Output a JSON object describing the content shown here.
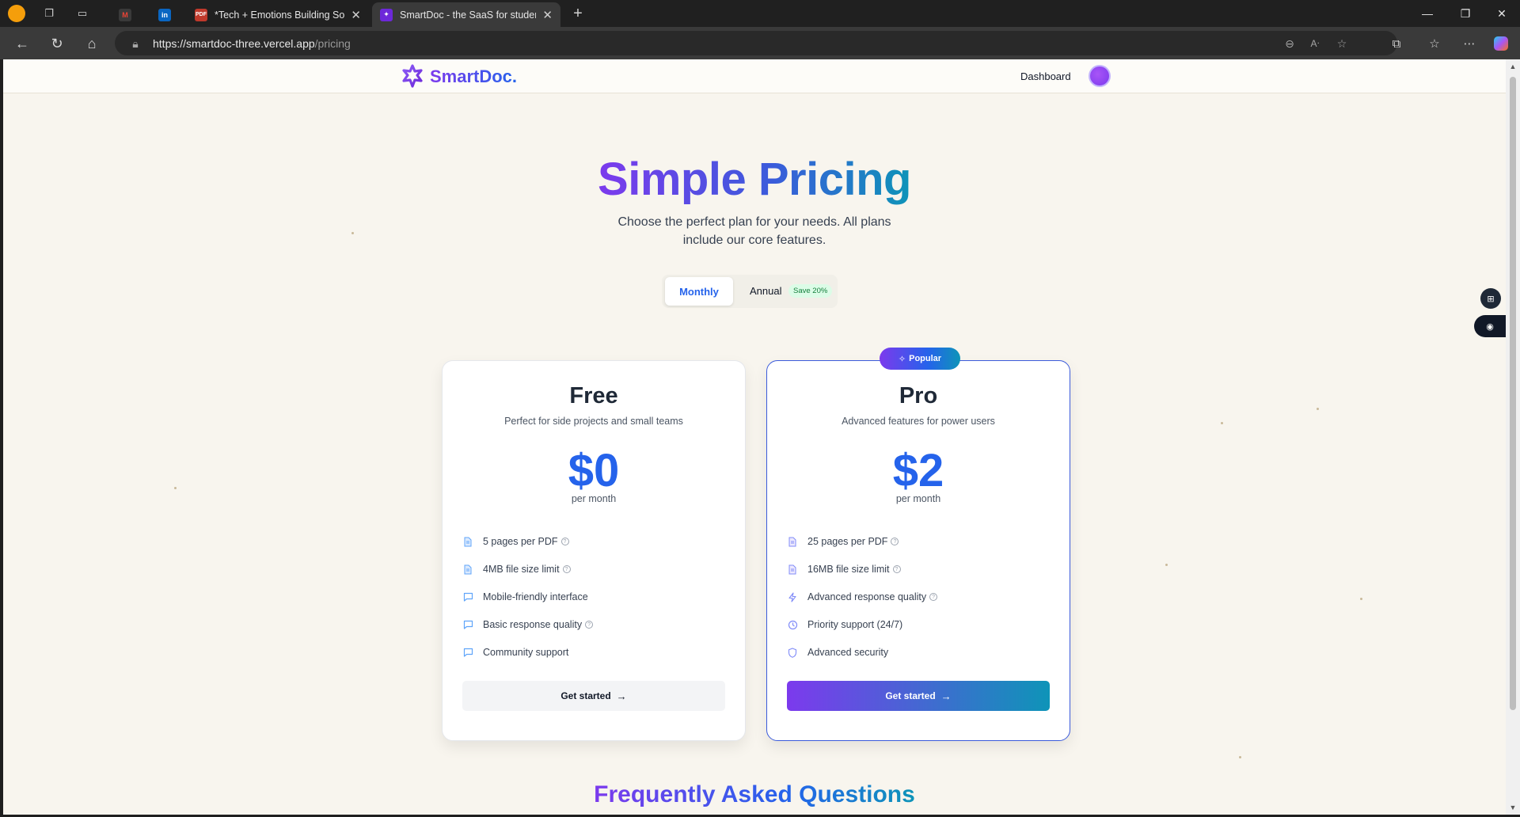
{
  "browser": {
    "tabs": [
      {
        "title": "",
        "favicon": "gmail-icon"
      },
      {
        "title": "",
        "favicon": "linkedin-icon"
      },
      {
        "title": "*Tech + Emotions Building Softwa",
        "favicon": "pdf-icon"
      },
      {
        "title": "SmartDoc - the SaaS for students",
        "favicon": "smartdoc-icon",
        "active": true
      }
    ],
    "url_host": "https://smartdoc-three.vercel.app",
    "url_path": "/pricing"
  },
  "header": {
    "logo_text": "SmartDoc.",
    "dashboard_label": "Dashboard"
  },
  "hero": {
    "title": "Simple Pricing",
    "subtitle": "Choose the perfect plan for your needs. All plans include our core features."
  },
  "billing_toggle": {
    "monthly_label": "Monthly",
    "annual_label": "Annual",
    "save_badge": "Save 20%",
    "selected": "Monthly"
  },
  "plans": [
    {
      "name": "Free",
      "description": "Perfect for side projects and small teams",
      "price": "$0",
      "period": "per month",
      "cta": "Get started",
      "features": [
        {
          "text": "5 pages per PDF",
          "icon": "document-icon",
          "help": true
        },
        {
          "text": "4MB file size limit",
          "icon": "document-icon",
          "help": true
        },
        {
          "text": "Mobile-friendly interface",
          "icon": "chat-icon",
          "help": false
        },
        {
          "text": "Basic response quality",
          "icon": "chat-icon",
          "help": true
        },
        {
          "text": "Community support",
          "icon": "chat-icon",
          "help": false
        }
      ]
    },
    {
      "name": "Pro",
      "badge": "Popular",
      "description": "Advanced features for power users",
      "price": "$2",
      "period": "per month",
      "cta": "Get started",
      "features": [
        {
          "text": "25 pages per PDF",
          "icon": "document-icon",
          "help": true
        },
        {
          "text": "16MB file size limit",
          "icon": "document-icon",
          "help": true
        },
        {
          "text": "Advanced response quality",
          "icon": "lightning-icon",
          "help": true
        },
        {
          "text": "Priority support (24/7)",
          "icon": "clock-icon",
          "help": false
        },
        {
          "text": "Advanced security",
          "icon": "shield-icon",
          "help": false
        }
      ]
    }
  ],
  "faq_title": "Frequently Asked Questions",
  "colors": {
    "accent_blue": "#2563eb",
    "accent_purple": "#7c3aed",
    "accent_teal": "#0e94b8",
    "page_bg": "#f8f5ee"
  }
}
